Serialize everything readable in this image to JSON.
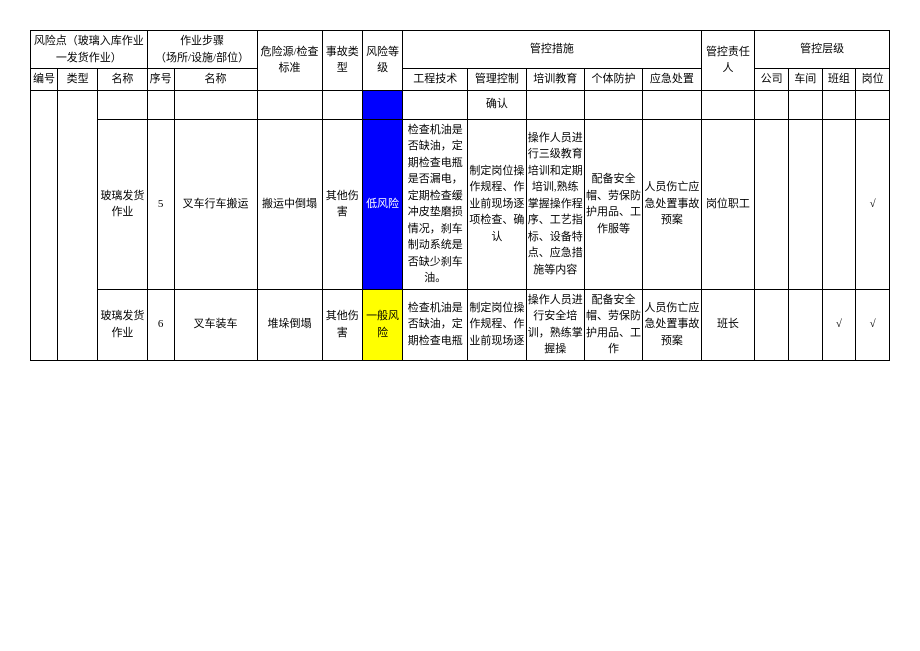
{
  "header": {
    "riskPoint": "风险点（玻璃入库作业一发货作业）",
    "workStep": "作业步骤\n（场所/设施/部位）",
    "hazard": "危险源/检查标准",
    "accidentType": "事故类型",
    "riskLevel": "风险等级",
    "controlMeasures": "管控措施",
    "responsible": "管控责任人",
    "controlLevel": "管控层级",
    "sub": {
      "no": "编号",
      "type": "类型",
      "name": "名称",
      "seq": "序号",
      "stepName": "名称",
      "engTech": "工程技术",
      "mgmtCtrl": "管理控制",
      "training": "培训教育",
      "ppe": "个体防护",
      "emergency": "应急处置",
      "company": "公司",
      "workshop": "车间",
      "team": "班组",
      "post": "岗位"
    }
  },
  "rows": {
    "confirmTail": "确认",
    "r5": {
      "name": "玻璃发货作业",
      "seq": "5",
      "stepName": "叉车行车搬运",
      "hazard": "搬运中倒塌",
      "accidentType": "其他伤害",
      "riskLevel": "低风险",
      "engTech": "检查机油是否缺油，定期检查电瓶是否漏电，定期检查缓冲皮垫磨损情况，刹车制动系统是否缺少刹车油。",
      "mgmtCtrl": "制定岗位操作规程、作业前现场逐项检查、确认",
      "training": "操作人员进行三级教育培训和定期培训,熟练掌握操作程序、工艺指标、设备特点、应急措施等内容",
      "ppe": "配备安全帽、劳保防护用品、工作服等",
      "emergency": "人员伤亡应急处置事故预案",
      "responsible": "岗位职工",
      "lvlTeam": "",
      "lvlPost": "√"
    },
    "r6": {
      "name": "玻璃发货作业",
      "seq": "6",
      "stepName": "叉车装车",
      "hazard": "堆垛倒塌",
      "accidentType": "其他伤害",
      "riskLevel": "一般风险",
      "engTech": "检查机油是否缺油，定期检查电瓶",
      "mgmtCtrl": "制定岗位操作规程、作业前现场逐",
      "training": "操作人员进行安全培训，熟练掌握操",
      "ppe": "配备安全帽、劳保防护用品、工作",
      "emergency": "人员伤亡应急处置事故预案",
      "responsible": "班长",
      "lvlTeam": "√",
      "lvlPost": "√"
    }
  }
}
